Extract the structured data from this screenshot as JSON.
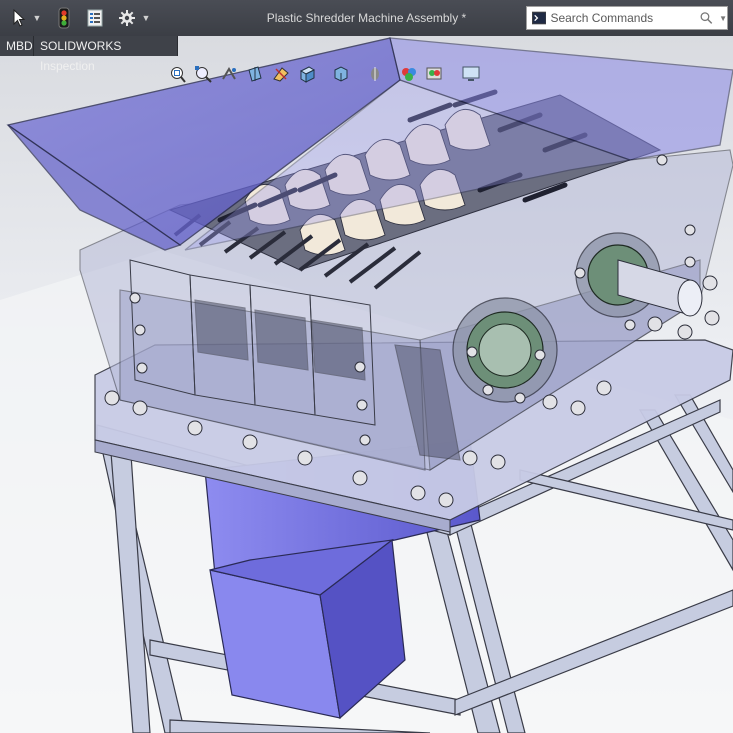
{
  "window": {
    "title": "Plastic Shredder Machine Assembly *",
    "document_type": "Assembly"
  },
  "toolbar": {
    "select_icon": "select-arrow-icon",
    "traffic_light_icon": "rebuild-status-icon",
    "file_properties_icon": "file-properties-icon",
    "options_icon": "gear-icon"
  },
  "search": {
    "placeholder": "Search Commands"
  },
  "tabs": [
    {
      "label": "MBD"
    },
    {
      "label": "SOLIDWORKS Inspection"
    }
  ],
  "view_toolbar": {
    "icons": [
      "zoom-to-fit-icon",
      "zoom-to-area-icon",
      "previous-view-icon",
      "section-view-icon",
      "dynamic-annotation-icon",
      "view-orientation-icon",
      "display-style-icon",
      "hide-show-items-icon",
      "edit-appearance-icon",
      "apply-scene-icon",
      "view-settings-icon"
    ]
  },
  "colors": {
    "titlebar": "#3d4047",
    "hopper_blue": "#7070e0",
    "transparent_housing": "#b8bcd8",
    "frame_steel": "#c8cfe0",
    "bolt": "#d8d8dc",
    "motor_green": "#5a8f6a"
  }
}
